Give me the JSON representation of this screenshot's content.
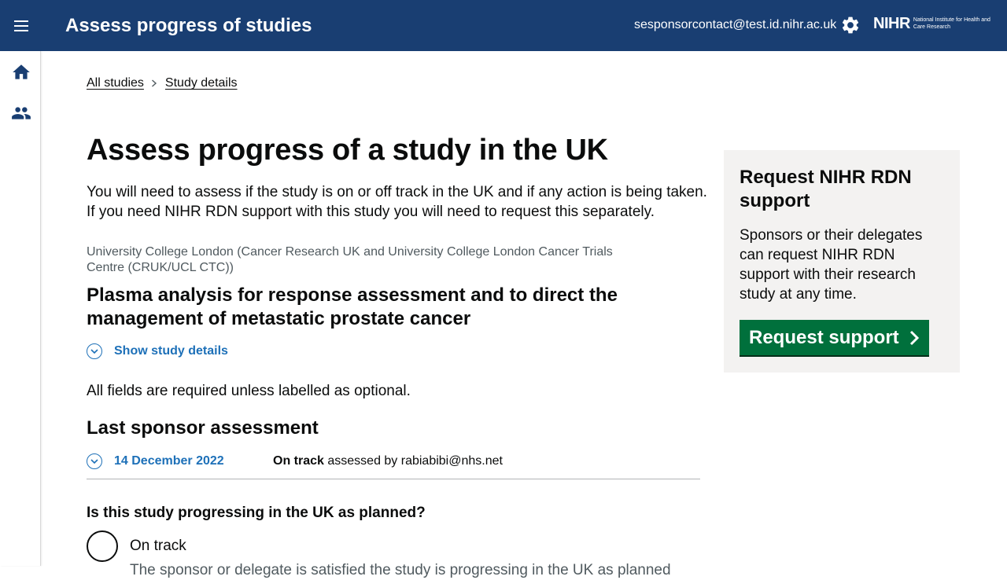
{
  "header": {
    "title": "Assess progress of studies",
    "user_email": "sesponsorcontact@test.id.nihr.ac.uk",
    "logo_main": "NIHR",
    "logo_sub": "National Institute for Health and Care Research"
  },
  "breadcrumbs": [
    "All studies",
    "Study details"
  ],
  "page": {
    "title": "Assess progress of a study in the UK",
    "intro": "You will need to assess if the study is on or off track in the UK and if any action is being taken. If you need NIHR RDN support with this study you will need to request this separately.",
    "organisation": "University College London (Cancer Research UK and University College London Cancer Trials Centre (CRUK/UCL CTC))",
    "study_title": "Plasma analysis for response assessment and to direct the management of metastatic prostate cancer",
    "show_details": "Show study details",
    "required_note": "All fields are required unless labelled as optional."
  },
  "last_assessment": {
    "heading": "Last sponsor assessment",
    "date": "14 December 2022",
    "status": "On track",
    "assessed_by": " assessed by rabiabibi@nhs.net"
  },
  "question": {
    "label": "Is this study progressing in the UK as planned?",
    "options": [
      {
        "label": "On track",
        "hint": "The sponsor or delegate is satisfied the study is progressing in the UK as planned"
      }
    ]
  },
  "support_panel": {
    "title": "Request NIHR RDN support",
    "text": "Sponsors or their delegates can request NIHR RDN support with their research study at any time.",
    "button": "Request support"
  },
  "colors": {
    "header_bg": "#193e72",
    "link": "#1d70b8",
    "button": "#00703c",
    "panel_bg": "#f3f2f1"
  },
  "icons": [
    "menu-icon",
    "settings-icon",
    "home-icon",
    "people-icon",
    "chevron-right-icon",
    "chevron-down-icon"
  ]
}
